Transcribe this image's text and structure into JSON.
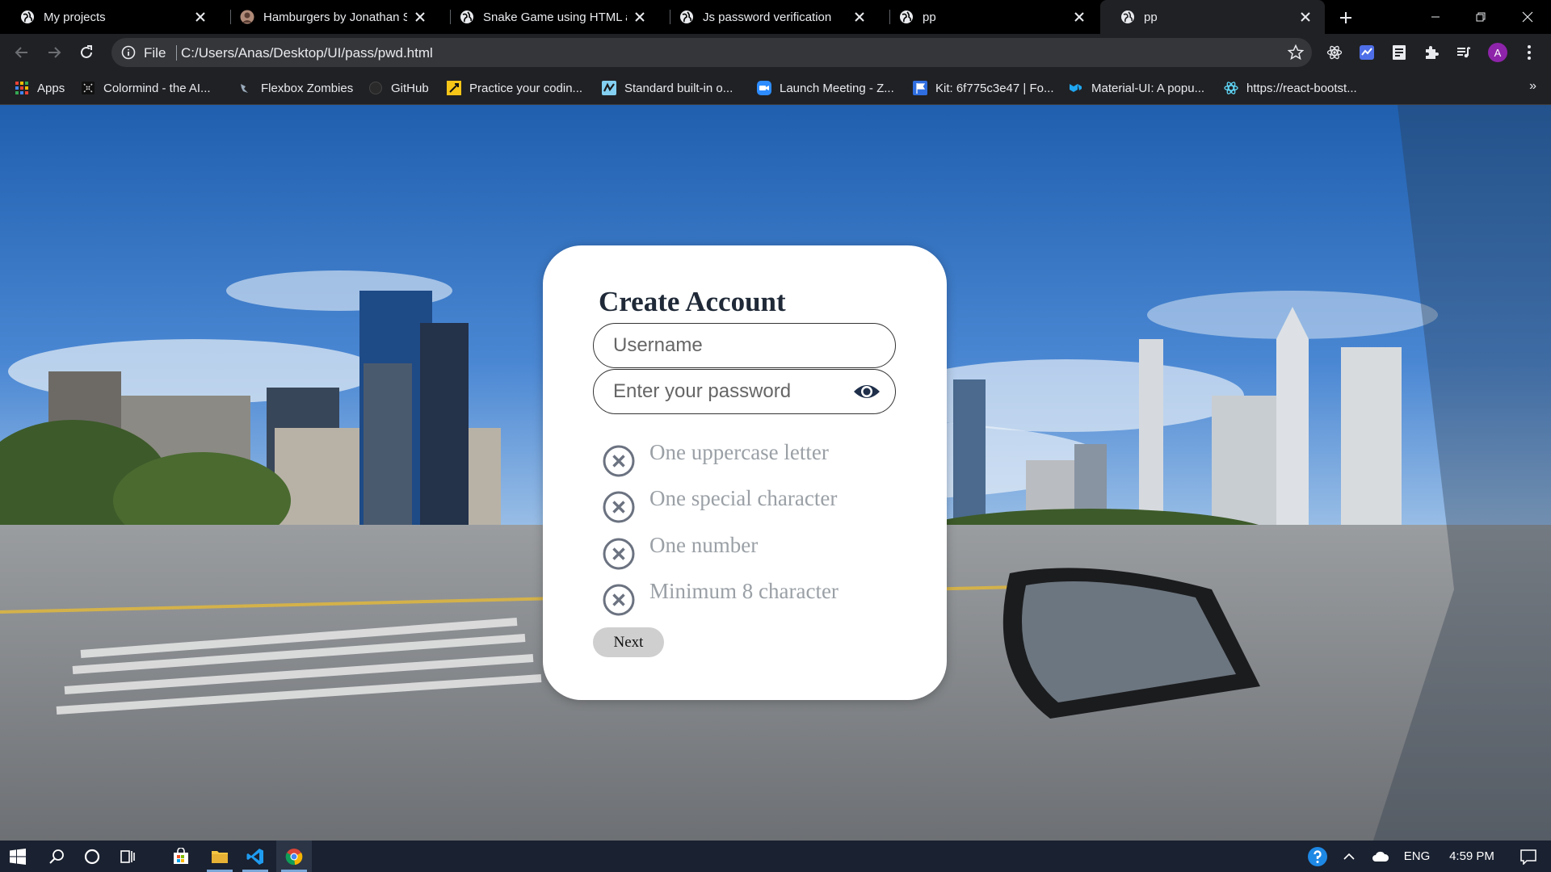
{
  "browser": {
    "tabs": [
      {
        "title": "My projects",
        "active": false
      },
      {
        "title": "Hamburgers by Jonathan Sut",
        "active": false
      },
      {
        "title": "Snake Game using HTML and",
        "active": false
      },
      {
        "title": "Js password verification",
        "active": false
      },
      {
        "title": "pp",
        "active": false
      },
      {
        "title": "pp",
        "active": true
      }
    ],
    "omnibox": {
      "scheme_label": "File",
      "url": "C:/Users/Anas/Desktop/UI/pass/pwd.html"
    },
    "profile_initial": "A",
    "bookmarks": [
      {
        "label": "Apps",
        "icon": "apps-grid-icon"
      },
      {
        "label": "Colormind - the AI...",
        "icon": "colormind-icon"
      },
      {
        "label": "Flexbox Zombies",
        "icon": "zombie-icon"
      },
      {
        "label": "GitHub",
        "icon": "github-icon"
      },
      {
        "label": "Practice your codin...",
        "icon": "practice-icon"
      },
      {
        "label": "Standard built-in o...",
        "icon": "mdn-icon"
      },
      {
        "label": "Launch Meeting - Z...",
        "icon": "zoom-icon"
      },
      {
        "label": "Kit: 6f775c3e47 | Fo...",
        "icon": "fontawesome-flag-icon"
      },
      {
        "label": "Material-UI: A popu...",
        "icon": "material-ui-icon"
      },
      {
        "label": "https://react-bootst...",
        "icon": "react-bootstrap-icon"
      }
    ],
    "bookmarks_more": "»"
  },
  "form": {
    "title": "Create Account",
    "username_placeholder": "Username",
    "password_placeholder": "Enter your password",
    "requirements": [
      "One uppercase letter",
      "One special character",
      "One number",
      "Minimum 8 character"
    ],
    "next_label": "Next"
  },
  "taskbar": {
    "language": "ENG",
    "time": "4:59 PM"
  },
  "colors": {
    "card_bg": "#ffffff",
    "requirement_text": "#9aa0a6",
    "next_button_bg": "#cfcfcf",
    "profile_avatar": "#8e24aa",
    "taskbar_bg": "#1a2130"
  }
}
